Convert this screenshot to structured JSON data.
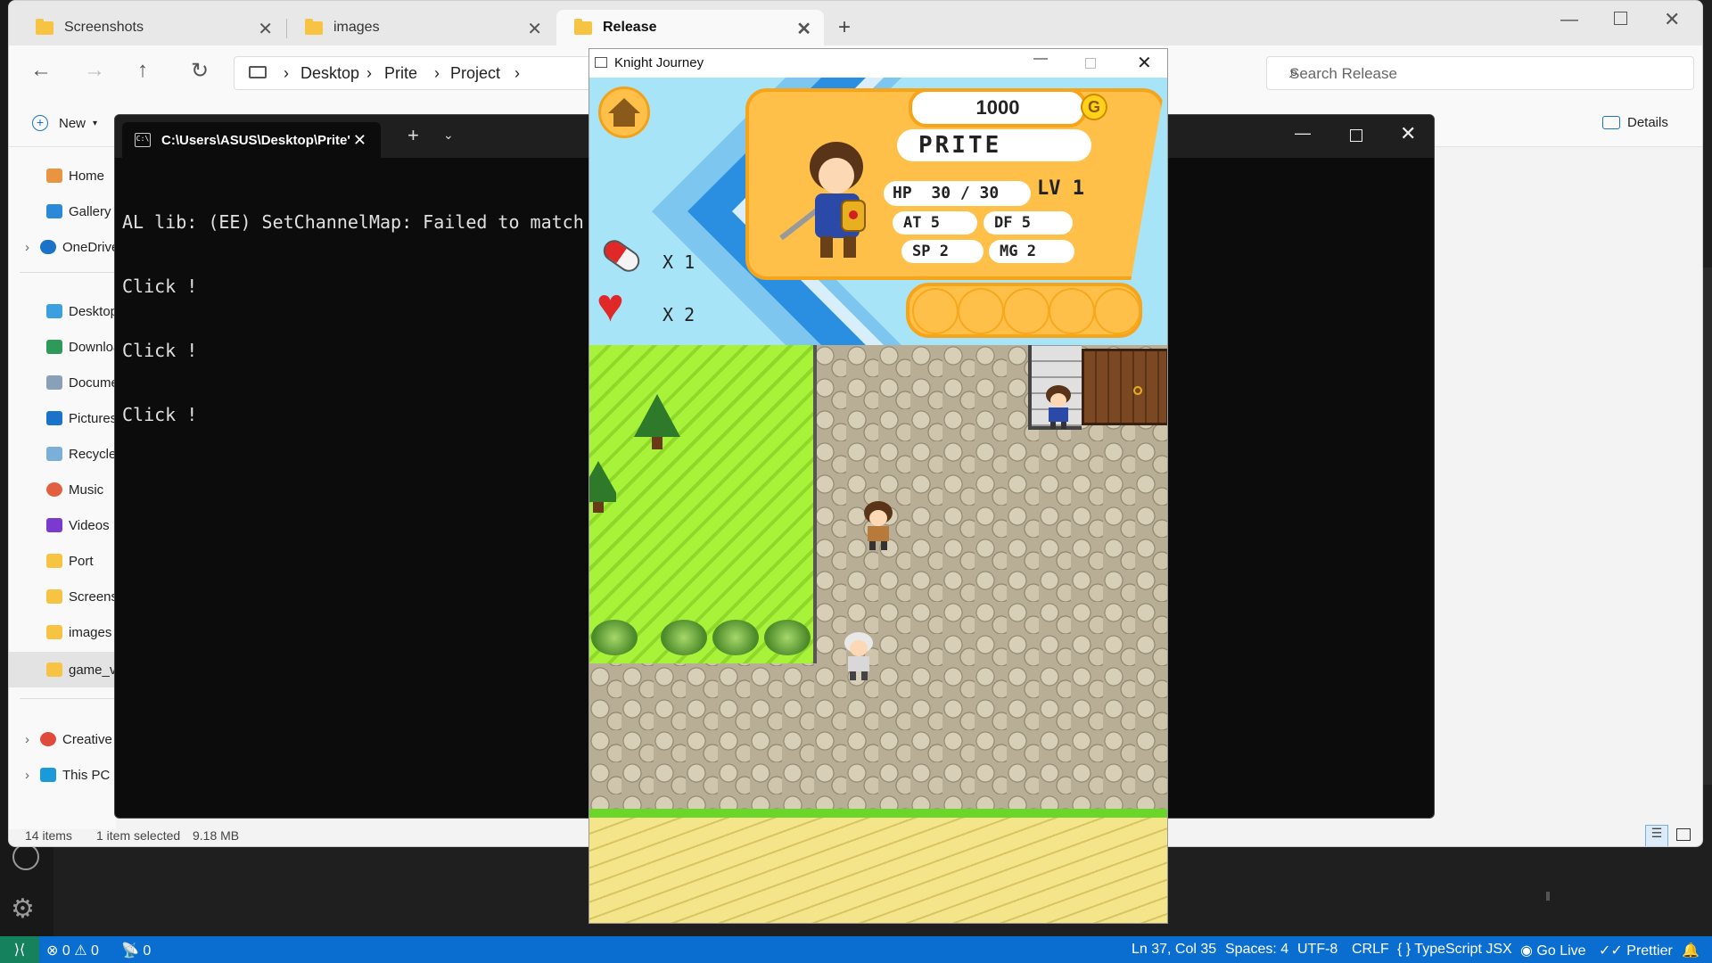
{
  "explorer": {
    "tabs": [
      {
        "label": "Screenshots"
      },
      {
        "label": "images"
      },
      {
        "label": "Release"
      }
    ],
    "breadcrumb": [
      "Desktop",
      "Prite",
      "Project"
    ],
    "search_placeholder": "Search Release",
    "toolbar": {
      "new_label": "New",
      "details_label": "Details"
    },
    "sidebar": [
      {
        "label": "Home"
      },
      {
        "label": "Gallery"
      },
      {
        "label": "OneDrive"
      },
      {
        "label": "Desktop"
      },
      {
        "label": "Downloads"
      },
      {
        "label": "Documents"
      },
      {
        "label": "Pictures"
      },
      {
        "label": "Recycle"
      },
      {
        "label": "Music"
      },
      {
        "label": "Videos"
      },
      {
        "label": "Port"
      },
      {
        "label": "Screens"
      },
      {
        "label": "images"
      },
      {
        "label": "game_v"
      },
      {
        "label": "Creative"
      },
      {
        "label": "This PC"
      }
    ],
    "status": {
      "items": "14 items",
      "selected": "1 item selected",
      "size": "9.18 MB"
    }
  },
  "terminal": {
    "tab_title": "C:\\Users\\ASUS\\Desktop\\Prite'",
    "lines": [
      "AL lib: (EE) SetChannelMap: Failed to match",
      "Click !",
      "Click !",
      "Click !"
    ]
  },
  "game": {
    "window_title": "Knight Journey",
    "coins": "1000",
    "coin_symbol": "G",
    "player_name": "PRITE",
    "hp_label": "HP",
    "hp_value": "30 / 30",
    "level_label": "LV",
    "level_value": "1",
    "at_label": "AT",
    "at_value": "5",
    "df_label": "DF",
    "df_value": "5",
    "sp_label": "SP",
    "sp_value": "2",
    "mg_label": "MG",
    "mg_value": "2",
    "pill_count": "X 1",
    "heart_count": "X 2"
  },
  "vscode_status": {
    "errors": "0",
    "warnings": "0",
    "ports": "0",
    "position": "Ln 37, Col 35",
    "spaces": "Spaces: 4",
    "encoding": "UTF-8",
    "eol": "CRLF",
    "language": "TypeScript JSX",
    "golive": "Go Live",
    "prettier": "Prettier"
  },
  "colors": {
    "hud_bg": "#a8e4f7",
    "grass": "#a8f23a",
    "panel": "#ffc04a",
    "status_bar": "#0a6ed1"
  }
}
